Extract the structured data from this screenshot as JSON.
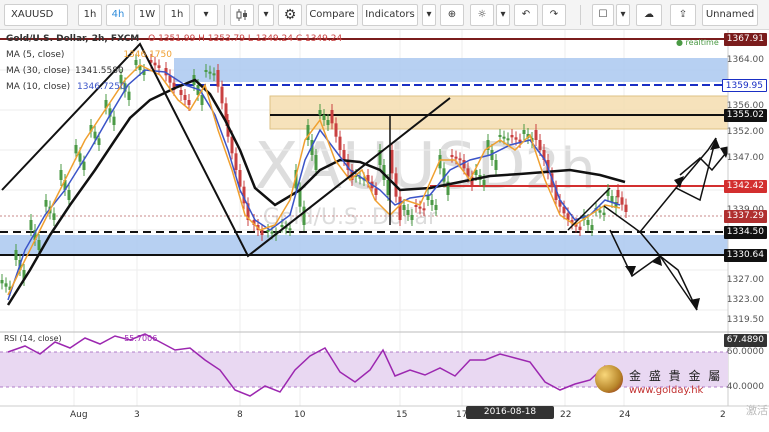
{
  "toolbar": {
    "symbol": "XAUUSD",
    "intervals": [
      "1h",
      "4h",
      "1W",
      "1h"
    ],
    "active_interval": "4h",
    "compare_label": "Compare",
    "indicators_label": "Indicators",
    "layout_name": "Unnamed"
  },
  "legend": {
    "title": "Gold/U.S. Dollar, 2h, FXCM",
    "ohlc": "O 1351.99 H 1353.79 L 1349.24 C 1349.24",
    "ma5": "MA (5, close)",
    "ma5_val": "1346.1750",
    "ma30": "MA (30, close)",
    "ma30_val": "1341.5580",
    "ma10": "MA (10, close)",
    "ma10_val": "1346.7250",
    "realtime": "realtime"
  },
  "price_labels": [
    {
      "value": "1367.91",
      "style": "dark-red"
    },
    {
      "value": "1359.95",
      "style": "blue"
    },
    {
      "value": "1355.02",
      "style": "black"
    },
    {
      "value": "1342.42",
      "style": "red"
    },
    {
      "value": "1337.29",
      "style": "dark-red"
    },
    {
      "value": "1334.50",
      "style": "black"
    },
    {
      "value": "1330.64",
      "style": "black"
    }
  ],
  "price_ticks": [
    "1364.00",
    "1356.00",
    "1352.00",
    "1347.00",
    "1339.00",
    "1327.00",
    "1323.00",
    "1319.50"
  ],
  "rsi": {
    "legend": "RSI (14, close)",
    "value": "55.7006",
    "label_value": "67.4890",
    "ticks": [
      "60.0000",
      "40.0000"
    ]
  },
  "date_axis": [
    "Aug",
    "3",
    "8",
    "10",
    "15",
    "17",
    "22",
    "24",
    "2"
  ],
  "crosshair_date": "2016-08-18 13:00:00",
  "watermark": {
    "symbol": "XAUUSD",
    "interval": "2h",
    "name": "Gold/U.S. Dollar"
  },
  "brand": {
    "name": "金 盛 貴 金 屬",
    "url": "www.golday.hk"
  },
  "corner_text": "激活",
  "colors": {
    "bull": "#4b9a45",
    "bear": "#c94040",
    "ma5": "#f0a030",
    "ma10": "#3b54c8",
    "ma30": "#111111",
    "rsi": "#9c27b0",
    "resistance": "#c62828",
    "support_zone": "#aac8f0",
    "supply_zone": "#f5deb0"
  }
}
